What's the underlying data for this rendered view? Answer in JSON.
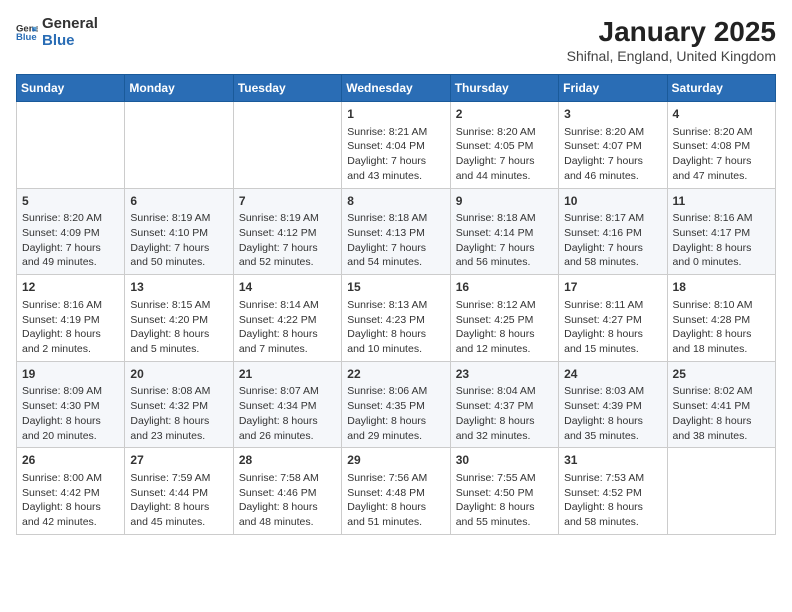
{
  "logo": {
    "general": "General",
    "blue": "Blue"
  },
  "title": "January 2025",
  "subtitle": "Shifnal, England, United Kingdom",
  "weekdays": [
    "Sunday",
    "Monday",
    "Tuesday",
    "Wednesday",
    "Thursday",
    "Friday",
    "Saturday"
  ],
  "weeks": [
    [
      {
        "day": "",
        "info": ""
      },
      {
        "day": "",
        "info": ""
      },
      {
        "day": "",
        "info": ""
      },
      {
        "day": "1",
        "info": "Sunrise: 8:21 AM\nSunset: 4:04 PM\nDaylight: 7 hours\nand 43 minutes."
      },
      {
        "day": "2",
        "info": "Sunrise: 8:20 AM\nSunset: 4:05 PM\nDaylight: 7 hours\nand 44 minutes."
      },
      {
        "day": "3",
        "info": "Sunrise: 8:20 AM\nSunset: 4:07 PM\nDaylight: 7 hours\nand 46 minutes."
      },
      {
        "day": "4",
        "info": "Sunrise: 8:20 AM\nSunset: 4:08 PM\nDaylight: 7 hours\nand 47 minutes."
      }
    ],
    [
      {
        "day": "5",
        "info": "Sunrise: 8:20 AM\nSunset: 4:09 PM\nDaylight: 7 hours\nand 49 minutes."
      },
      {
        "day": "6",
        "info": "Sunrise: 8:19 AM\nSunset: 4:10 PM\nDaylight: 7 hours\nand 50 minutes."
      },
      {
        "day": "7",
        "info": "Sunrise: 8:19 AM\nSunset: 4:12 PM\nDaylight: 7 hours\nand 52 minutes."
      },
      {
        "day": "8",
        "info": "Sunrise: 8:18 AM\nSunset: 4:13 PM\nDaylight: 7 hours\nand 54 minutes."
      },
      {
        "day": "9",
        "info": "Sunrise: 8:18 AM\nSunset: 4:14 PM\nDaylight: 7 hours\nand 56 minutes."
      },
      {
        "day": "10",
        "info": "Sunrise: 8:17 AM\nSunset: 4:16 PM\nDaylight: 7 hours\nand 58 minutes."
      },
      {
        "day": "11",
        "info": "Sunrise: 8:16 AM\nSunset: 4:17 PM\nDaylight: 8 hours\nand 0 minutes."
      }
    ],
    [
      {
        "day": "12",
        "info": "Sunrise: 8:16 AM\nSunset: 4:19 PM\nDaylight: 8 hours\nand 2 minutes."
      },
      {
        "day": "13",
        "info": "Sunrise: 8:15 AM\nSunset: 4:20 PM\nDaylight: 8 hours\nand 5 minutes."
      },
      {
        "day": "14",
        "info": "Sunrise: 8:14 AM\nSunset: 4:22 PM\nDaylight: 8 hours\nand 7 minutes."
      },
      {
        "day": "15",
        "info": "Sunrise: 8:13 AM\nSunset: 4:23 PM\nDaylight: 8 hours\nand 10 minutes."
      },
      {
        "day": "16",
        "info": "Sunrise: 8:12 AM\nSunset: 4:25 PM\nDaylight: 8 hours\nand 12 minutes."
      },
      {
        "day": "17",
        "info": "Sunrise: 8:11 AM\nSunset: 4:27 PM\nDaylight: 8 hours\nand 15 minutes."
      },
      {
        "day": "18",
        "info": "Sunrise: 8:10 AM\nSunset: 4:28 PM\nDaylight: 8 hours\nand 18 minutes."
      }
    ],
    [
      {
        "day": "19",
        "info": "Sunrise: 8:09 AM\nSunset: 4:30 PM\nDaylight: 8 hours\nand 20 minutes."
      },
      {
        "day": "20",
        "info": "Sunrise: 8:08 AM\nSunset: 4:32 PM\nDaylight: 8 hours\nand 23 minutes."
      },
      {
        "day": "21",
        "info": "Sunrise: 8:07 AM\nSunset: 4:34 PM\nDaylight: 8 hours\nand 26 minutes."
      },
      {
        "day": "22",
        "info": "Sunrise: 8:06 AM\nSunset: 4:35 PM\nDaylight: 8 hours\nand 29 minutes."
      },
      {
        "day": "23",
        "info": "Sunrise: 8:04 AM\nSunset: 4:37 PM\nDaylight: 8 hours\nand 32 minutes."
      },
      {
        "day": "24",
        "info": "Sunrise: 8:03 AM\nSunset: 4:39 PM\nDaylight: 8 hours\nand 35 minutes."
      },
      {
        "day": "25",
        "info": "Sunrise: 8:02 AM\nSunset: 4:41 PM\nDaylight: 8 hours\nand 38 minutes."
      }
    ],
    [
      {
        "day": "26",
        "info": "Sunrise: 8:00 AM\nSunset: 4:42 PM\nDaylight: 8 hours\nand 42 minutes."
      },
      {
        "day": "27",
        "info": "Sunrise: 7:59 AM\nSunset: 4:44 PM\nDaylight: 8 hours\nand 45 minutes."
      },
      {
        "day": "28",
        "info": "Sunrise: 7:58 AM\nSunset: 4:46 PM\nDaylight: 8 hours\nand 48 minutes."
      },
      {
        "day": "29",
        "info": "Sunrise: 7:56 AM\nSunset: 4:48 PM\nDaylight: 8 hours\nand 51 minutes."
      },
      {
        "day": "30",
        "info": "Sunrise: 7:55 AM\nSunset: 4:50 PM\nDaylight: 8 hours\nand 55 minutes."
      },
      {
        "day": "31",
        "info": "Sunrise: 7:53 AM\nSunset: 4:52 PM\nDaylight: 8 hours\nand 58 minutes."
      },
      {
        "day": "",
        "info": ""
      }
    ]
  ]
}
